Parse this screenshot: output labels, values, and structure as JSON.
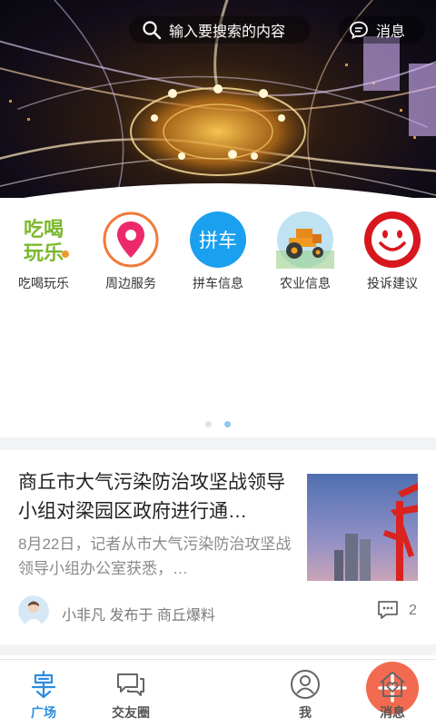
{
  "search": {
    "placeholder": "输入要搜索的内容"
  },
  "header": {
    "message_label": "消息"
  },
  "categories": [
    {
      "label": "吃喝玩乐",
      "icon": "food-fun-icon",
      "icon_text_top": "吃喝",
      "icon_text_bottom": "玩乐"
    },
    {
      "label": "周边服务",
      "icon": "location-pin-icon"
    },
    {
      "label": "拼车信息",
      "icon": "carpool-icon",
      "icon_text": "拼车"
    },
    {
      "label": "农业信息",
      "icon": "tractor-icon"
    },
    {
      "label": "投诉建议",
      "icon": "smiley-icon"
    }
  ],
  "pager": {
    "pages": 2,
    "current": 2
  },
  "feed": [
    {
      "title": "商丘市大气污染防治攻坚战领导小组对梁园区政府进行通…",
      "summary": "8月22日，记者从市大气污染防治攻坚战领导小组办公室获悉，…",
      "author_line": "小非凡 发布于 商丘爆料",
      "comment_count": "2"
    }
  ],
  "nav": [
    {
      "label": "广场",
      "icon": "square-icon",
      "active": true
    },
    {
      "label": "交友圈",
      "icon": "chat-bubbles-icon",
      "active": false
    },
    {
      "label": "",
      "icon": "plus-icon",
      "active": false
    },
    {
      "label": "我",
      "icon": "user-icon",
      "active": false
    },
    {
      "label": "消息",
      "icon": "home-heart-icon",
      "active": false
    }
  ],
  "colors": {
    "accent": "#2b8ce0",
    "plus_button": "#f26a4f",
    "pager_active": "#8ec9ef"
  }
}
